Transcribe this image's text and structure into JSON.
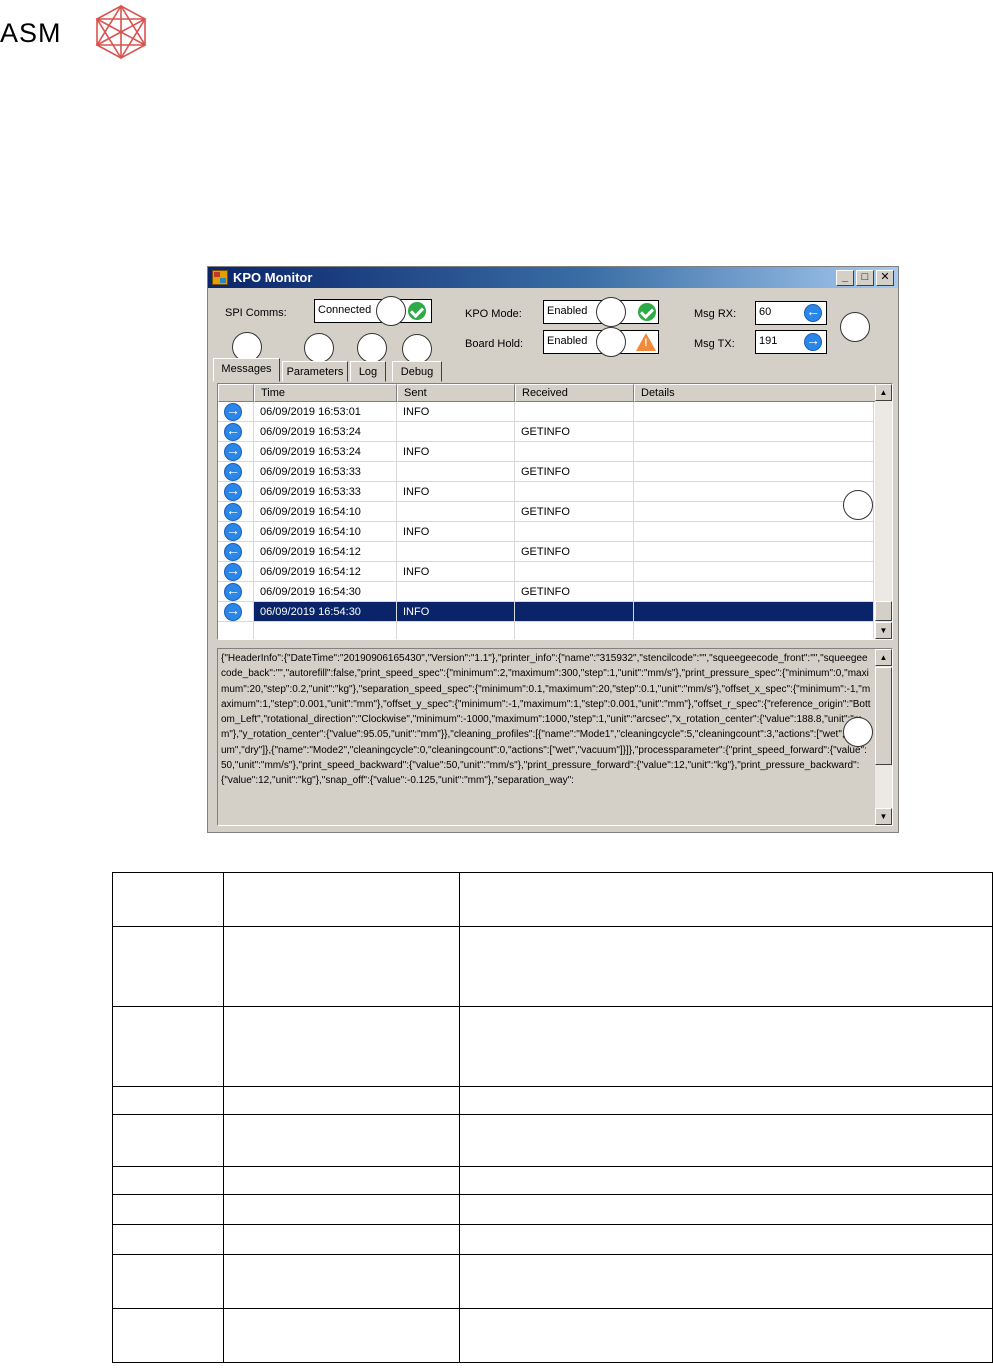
{
  "logo": {
    "text": "ASM"
  },
  "window": {
    "title": "KPO Monitor",
    "buttons": {
      "minimize": "_",
      "maximize": "□",
      "close": "✕"
    }
  },
  "status": {
    "spi_comms": {
      "label": "SPI Comms:",
      "value": "Connected",
      "icon": "check-icon"
    },
    "kpo_mode": {
      "label": "KPO Mode:",
      "value": "Enabled",
      "icon": "check-icon"
    },
    "board_hold": {
      "label": "Board Hold:",
      "value": "Enabled",
      "icon": "warning-icon"
    },
    "msg_rx": {
      "label": "Msg RX:",
      "value": "60",
      "icon": "arrow-left-icon"
    },
    "msg_tx": {
      "label": "Msg TX:",
      "value": "191",
      "icon": "arrow-right-icon"
    }
  },
  "tabs": [
    {
      "label": "Messages",
      "active": true
    },
    {
      "label": "Parameters",
      "active": false
    },
    {
      "label": "Log",
      "active": false
    },
    {
      "label": "Debug",
      "active": false
    }
  ],
  "grid": {
    "columns": [
      "",
      "Time",
      "Sent",
      "Received",
      "Details"
    ],
    "rows": [
      {
        "direction": "out",
        "time": "06/09/2019 16:53:01",
        "sent": "INFO",
        "received": "",
        "details": ""
      },
      {
        "direction": "in",
        "time": "06/09/2019 16:53:24",
        "sent": "",
        "received": "GETINFO",
        "details": ""
      },
      {
        "direction": "out",
        "time": "06/09/2019 16:53:24",
        "sent": "INFO",
        "received": "",
        "details": ""
      },
      {
        "direction": "in",
        "time": "06/09/2019 16:53:33",
        "sent": "",
        "received": "GETINFO",
        "details": ""
      },
      {
        "direction": "out",
        "time": "06/09/2019 16:53:33",
        "sent": "INFO",
        "received": "",
        "details": ""
      },
      {
        "direction": "in",
        "time": "06/09/2019 16:54:10",
        "sent": "",
        "received": "GETINFO",
        "details": ""
      },
      {
        "direction": "out",
        "time": "06/09/2019 16:54:10",
        "sent": "INFO",
        "received": "",
        "details": ""
      },
      {
        "direction": "in",
        "time": "06/09/2019 16:54:12",
        "sent": "",
        "received": "GETINFO",
        "details": ""
      },
      {
        "direction": "out",
        "time": "06/09/2019 16:54:12",
        "sent": "INFO",
        "received": "",
        "details": ""
      },
      {
        "direction": "in",
        "time": "06/09/2019 16:54:30",
        "sent": "",
        "received": "GETINFO",
        "details": ""
      },
      {
        "direction": "out",
        "time": "06/09/2019 16:54:30",
        "sent": "INFO",
        "received": "",
        "details": "",
        "selected": true
      }
    ]
  },
  "details_text": "{\"HeaderInfo\":{\"DateTime\":\"20190906165430\",\"Version\":\"1.1\"},\"printer_info\":{\"name\":\"315932\",\"stencilcode\":\"\",\"squeegeecode_front\":\"\",\"squeegeecode_back\":\"\",\"autorefill\":false,\"print_speed_spec\":{\"minimum\":2,\"maximum\":300,\"step\":1,\"unit\":\"mm/s\"},\"print_pressure_spec\":{\"minimum\":0,\"maximum\":20,\"step\":0.2,\"unit\":\"kg\"},\"separation_speed_spec\":{\"minimum\":0.1,\"maximum\":20,\"step\":0.1,\"unit\":\"mm/s\"},\"offset_x_spec\":{\"minimum\":-1,\"maximum\":1,\"step\":0.001,\"unit\":\"mm\"},\"offset_y_spec\":{\"minimum\":-1,\"maximum\":1,\"step\":0.001,\"unit\":\"mm\"},\"offset_r_spec\":{\"reference_origin\":\"Bottom_Left\",\"rotational_direction\":\"Clockwise\",\"minimum\":-1000,\"maximum\":1000,\"step\":1,\"unit\":\"arcsec\",\"x_rotation_center\":{\"value\":188.8,\"unit\":\"mm\"},\"y_rotation_center\":{\"value\":95.05,\"unit\":\"mm\"}},\"cleaning_profiles\":[{\"name\":\"Mode1\",\"cleaningcycle\":5,\"cleaningcount\":3,\"actions\":[\"wet\",\"vacuum\",\"dry\"]},{\"name\":\"Mode2\",\"cleaningcycle\":0,\"cleaningcount\":0,\"actions\":[\"wet\",\"vacuum\"]}]},\"processparameter\":{\"print_speed_forward\":{\"value\":50,\"unit\":\"mm/s\"},\"print_speed_backward\":{\"value\":50,\"unit\":\"mm/s\"},\"print_pressure_forward\":{\"value\":12,\"unit\":\"kg\"},\"print_pressure_backward\":{\"value\":12,\"unit\":\"kg\"},\"snap_off\":{\"value\":-0.125,\"unit\":\"mm\"},\"separation_way\":"
}
